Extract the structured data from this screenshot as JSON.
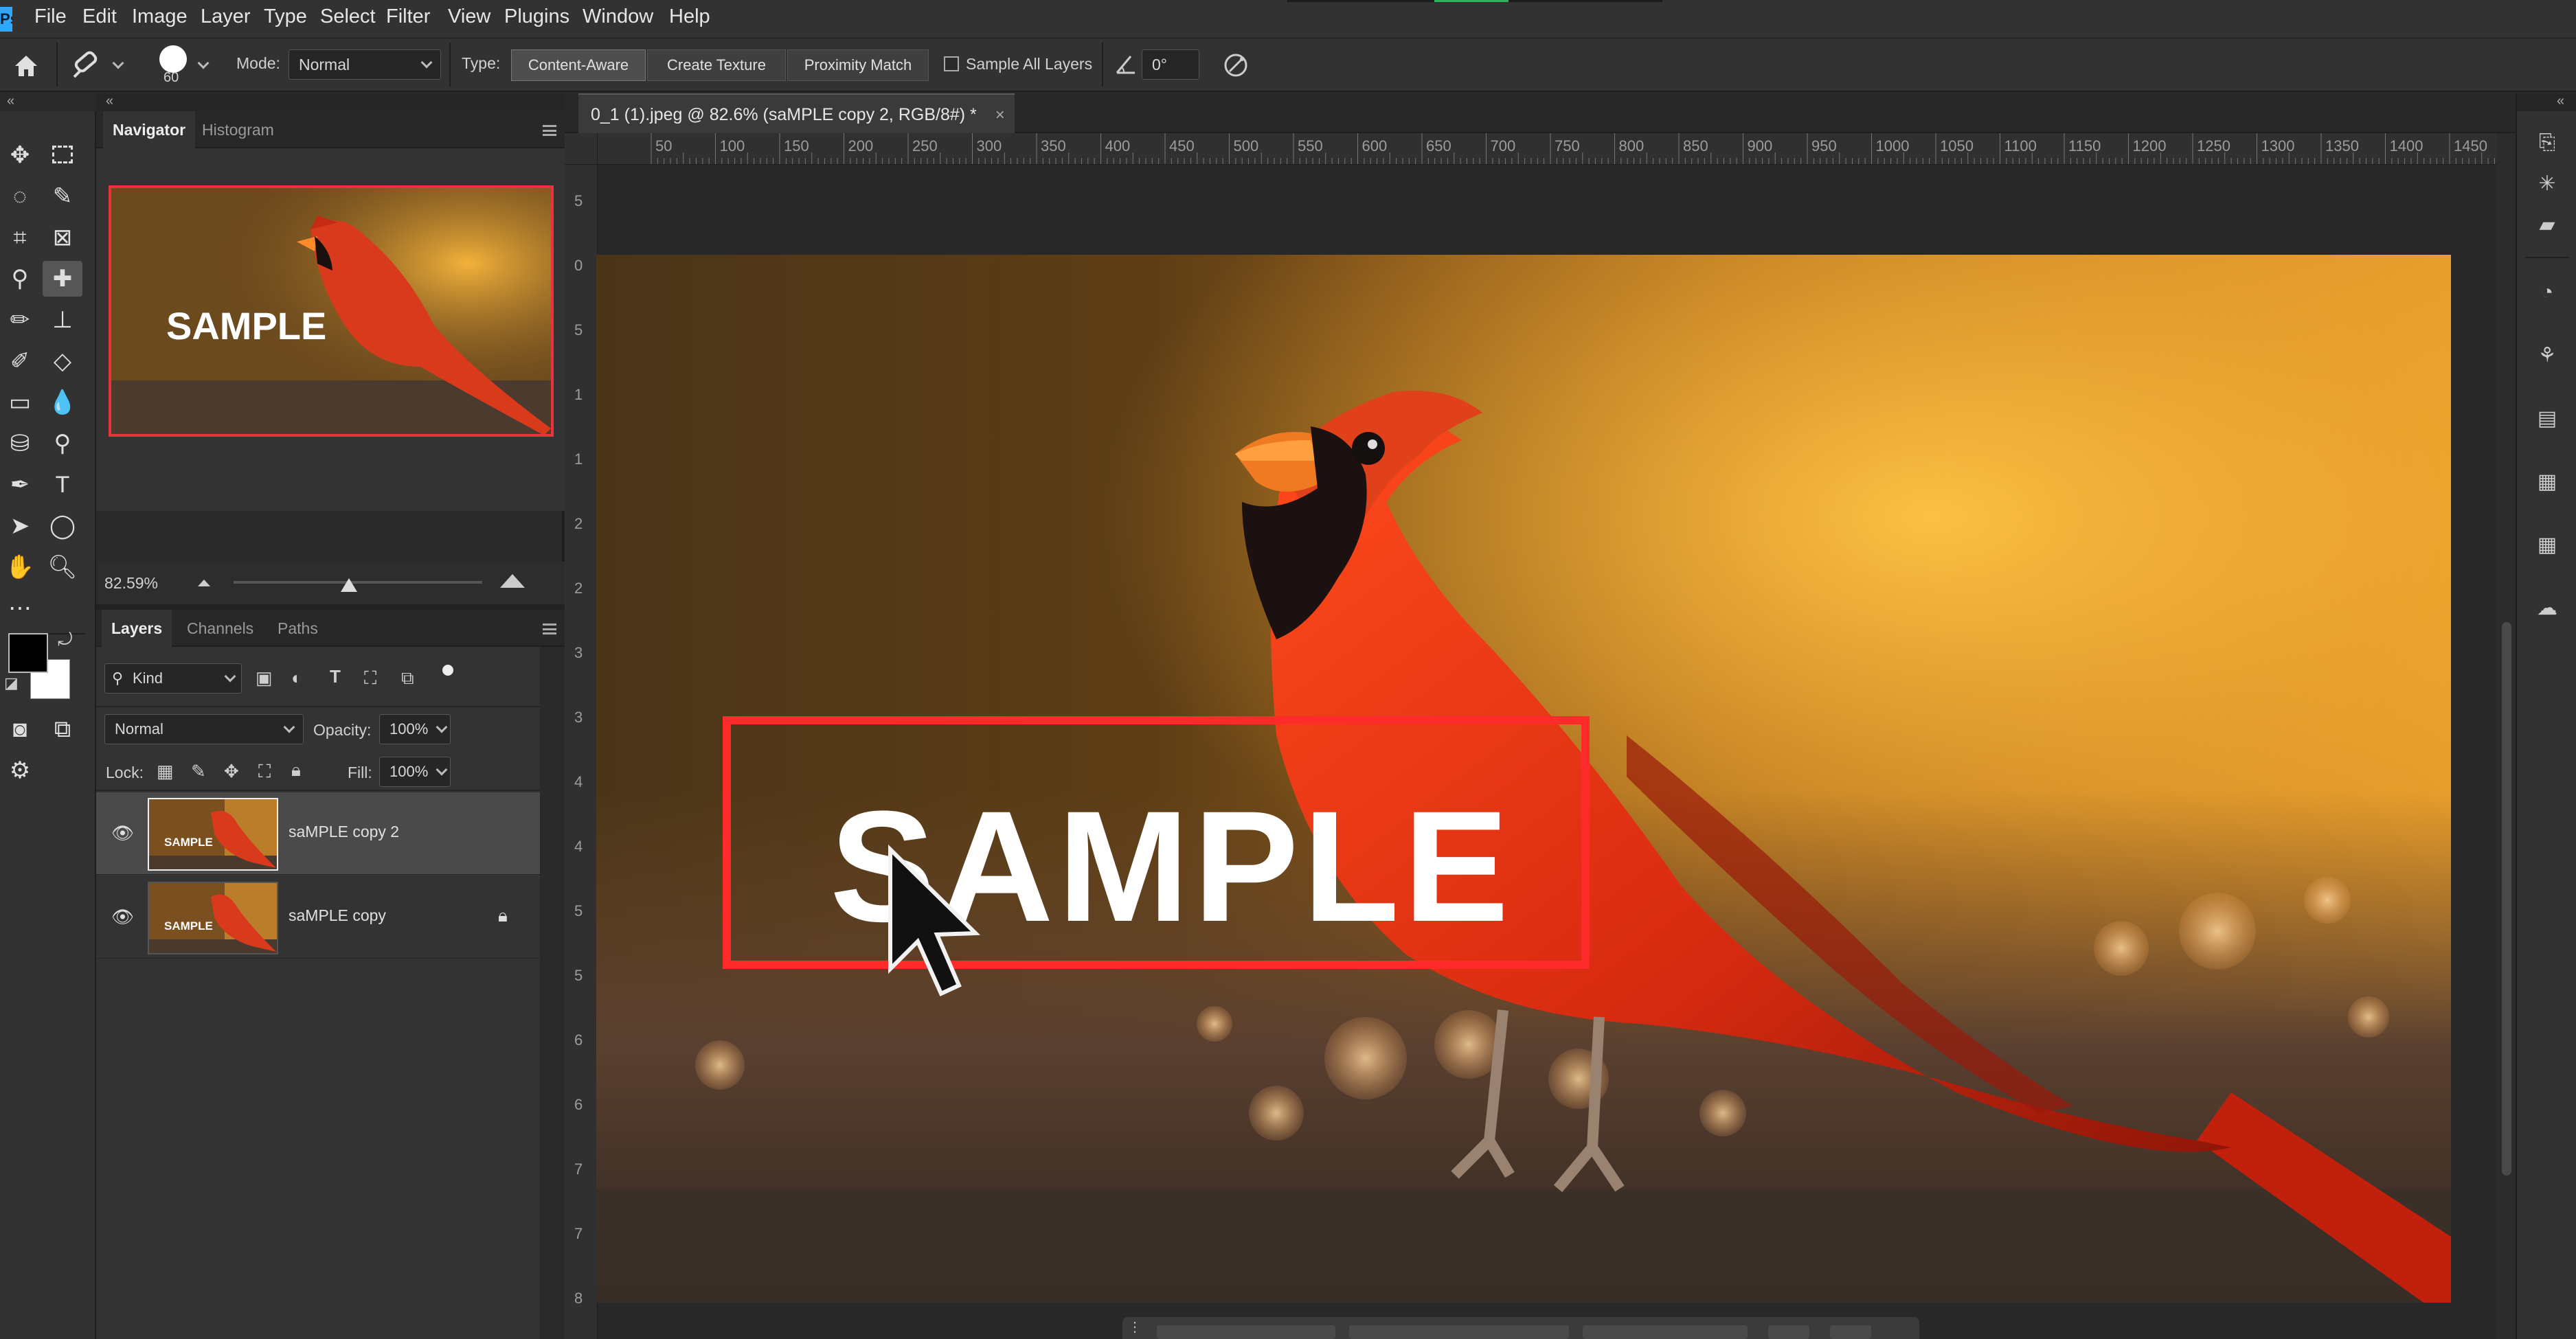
{
  "menubar": {
    "app_icon": "Ps",
    "items": [
      "File",
      "Edit",
      "Image",
      "Layer",
      "Type",
      "Select",
      "Filter",
      "View",
      "Plugins",
      "Window",
      "Help"
    ]
  },
  "options": {
    "home_icon": "home-icon",
    "brush_size": "60",
    "mode_label": "Mode:",
    "mode_value": "Normal",
    "type_label": "Type:",
    "type_buttons": [
      "Content-Aware",
      "Create Texture",
      "Proximity Match"
    ],
    "sample_all_layers": "Sample All Layers",
    "angle_value": "0°"
  },
  "navigator": {
    "tabs": [
      "Navigator",
      "Histogram"
    ],
    "zoom": "82.59%"
  },
  "layers_panel": {
    "tabs": [
      "Layers",
      "Channels",
      "Paths"
    ],
    "filter_kind": "Kind",
    "blend_mode": "Normal",
    "opacity_label": "Opacity:",
    "opacity_value": "100%",
    "lock_label": "Lock:",
    "fill_label": "Fill:",
    "fill_value": "100%",
    "layers": [
      {
        "name": "saMPLE copy 2",
        "selected": true,
        "locked": false
      },
      {
        "name": "saMPLE copy",
        "selected": false,
        "locked": true
      }
    ]
  },
  "document": {
    "tab_title": "0_1 (1).jpeg @ 82.6% (saMPLE copy 2, RGB/8#) *",
    "watermark_text": "SAMPLE",
    "thumb_text": "SAMPLE"
  },
  "ruler": {
    "h_ticks": [
      "50",
      "100",
      "150",
      "200",
      "250",
      "300",
      "350",
      "400",
      "450",
      "500",
      "550",
      "600",
      "650",
      "700",
      "750",
      "800",
      "850",
      "900",
      "950",
      "1000",
      "1050",
      "1100",
      "1150",
      "1200",
      "1250",
      "1300",
      "1350",
      "1400",
      "1450"
    ],
    "v_ticks": [
      "5",
      "0",
      "5",
      "1",
      "1",
      "2",
      "2",
      "3",
      "3",
      "4",
      "4",
      "5",
      "5",
      "6",
      "6",
      "7",
      "7",
      "8"
    ]
  },
  "colors": {
    "accent_red": "#e8333c",
    "foreground": "#000000",
    "background": "#ffffff"
  }
}
